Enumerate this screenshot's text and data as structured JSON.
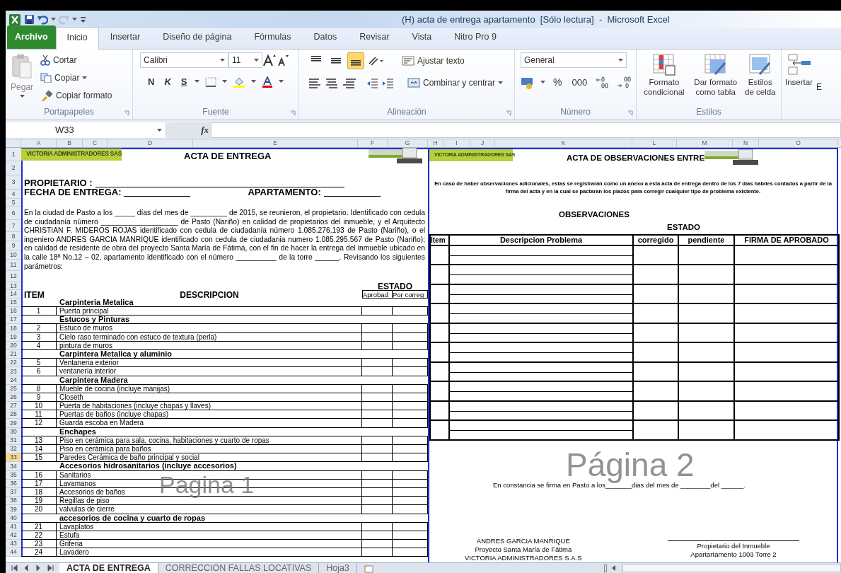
{
  "window": {
    "title": "(H) acta de entrega apartamento  [Sólo lectura]  -  Microsoft Excel"
  },
  "ribbon_tabs": [
    {
      "label": "Archivo",
      "kind": "file",
      "selected": false
    },
    {
      "label": "Inicio",
      "kind": "tab",
      "selected": true
    },
    {
      "label": "Insertar",
      "kind": "tab",
      "selected": false
    },
    {
      "label": "Diseño de página",
      "kind": "tab",
      "selected": false
    },
    {
      "label": "Fórmulas",
      "kind": "tab",
      "selected": false
    },
    {
      "label": "Datos",
      "kind": "tab",
      "selected": false
    },
    {
      "label": "Revisar",
      "kind": "tab",
      "selected": false
    },
    {
      "label": "Vista",
      "kind": "tab",
      "selected": false
    },
    {
      "label": "Nitro Pro 9",
      "kind": "tab",
      "selected": false
    }
  ],
  "clipboard": {
    "paste": "Pegar",
    "cut": "Cortar",
    "copy": "Copiar",
    "format_painter": "Copiar formato",
    "group": "Portapapeles"
  },
  "font": {
    "name": "Calibri",
    "size": "11",
    "bold": "N",
    "italic": "K",
    "underline": "S",
    "group": "Fuente"
  },
  "alignment": {
    "wrap": "Ajustar texto",
    "merge": "Combinar y centrar",
    "group": "Alineación",
    "vertical": [
      {
        "selected": false
      },
      {
        "selected": false
      },
      {
        "selected": true
      }
    ]
  },
  "number": {
    "format": "General",
    "percent": "%",
    "thousands": "000",
    "group": "Número"
  },
  "styles": {
    "conditional": "Formato condicional",
    "table": "Dar formato como tabla",
    "cell": "Estilos de celda",
    "group": "Estilos"
  },
  "cells": {
    "insert": "Insertar",
    "next": "E"
  },
  "formula_bar": {
    "name_box": "W33",
    "fx": "fx"
  },
  "columns_left": [
    "A",
    "B",
    "C",
    "D",
    "E",
    "F",
    "G"
  ],
  "columns_right": [
    "H",
    "I",
    "J",
    "K",
    "L",
    "M",
    "N",
    "O"
  ],
  "row_headers": [
    {
      "label": "1",
      "selected": false
    },
    {
      "label": "2",
      "selected": false
    },
    {
      "label": "3",
      "selected": false
    },
    {
      "label": "4",
      "selected": false
    },
    {
      "label": "5",
      "selected": false
    },
    {
      "label": "6",
      "selected": false
    },
    {
      "label": "7",
      "selected": false
    },
    {
      "label": "8",
      "selected": false
    },
    {
      "label": "9",
      "selected": false
    },
    {
      "label": "10",
      "selected": false
    },
    {
      "label": "11",
      "selected": false
    },
    {
      "label": "12",
      "selected": false
    },
    {
      "label": "13",
      "selected": false
    },
    {
      "label": "14",
      "selected": false
    },
    {
      "label": "15",
      "selected": false
    },
    {
      "label": "16",
      "selected": false
    },
    {
      "label": "17",
      "selected": false
    },
    {
      "label": "18",
      "selected": false
    },
    {
      "label": "19",
      "selected": false
    },
    {
      "label": "20",
      "selected": false
    },
    {
      "label": "21",
      "selected": false
    },
    {
      "label": "22",
      "selected": false
    },
    {
      "label": "23",
      "selected": false
    },
    {
      "label": "24",
      "selected": false
    },
    {
      "label": "25",
      "selected": false
    },
    {
      "label": "26",
      "selected": false
    },
    {
      "label": "27",
      "selected": false
    },
    {
      "label": "28",
      "selected": false
    },
    {
      "label": "29",
      "selected": false
    },
    {
      "label": "30",
      "selected": false
    },
    {
      "label": "31",
      "selected": false
    },
    {
      "label": "32",
      "selected": false
    },
    {
      "label": "33",
      "selected": true
    },
    {
      "label": "34",
      "selected": false
    },
    {
      "label": "35",
      "selected": false
    },
    {
      "label": "36",
      "selected": false
    },
    {
      "label": "37",
      "selected": false
    },
    {
      "label": "38",
      "selected": false
    },
    {
      "label": "39",
      "selected": false
    },
    {
      "label": "40",
      "selected": false
    },
    {
      "label": "41",
      "selected": false
    },
    {
      "label": "42",
      "selected": false
    },
    {
      "label": "43",
      "selected": false
    },
    {
      "label": "44",
      "selected": false
    }
  ],
  "page1": {
    "logo_text": "VICTORIA ADMINISTRADORES SAS",
    "title": "ACTA DE ENTREGA",
    "owner_label": "PROPIETARIO :",
    "date_label": "FECHA DE ENTREGA:",
    "apartment_label": "APARTAMENTO:",
    "paragraph": "En la ciudad de Pasto a los _____ días del mes de _________ de 2015, se reunieron, el propietario. Identificado con cedula de ciudadanía número ___________________ de Pasto (Nariño) en calidad de propietarios del inmueble, y el Arquitecto CHRISTIAN F. MIDEROS ROJAS identificado con cedula de ciudadanía número 1.085.276.193 de Pasto (Nariño), o el ingeniero ANDRES GARCIA MANRIQUE identificado con cedula de ciudadania numero 1.085.295.567 de Pasto (Nariño); en calidad de residente de obra del proyecto Santa María de Fátima, con el fin de hacer la entrega del inmueble ubicado en la calle 18ª No.12 – 02, apartamento identificado con el número __________ de la torre ______. Revisando los siguientes parámetros:",
    "status": "ESTADO",
    "item_header": "ITEM",
    "description_header": "DESCRIPCION",
    "approved_header": "Aprobad",
    "to_fix_header": "Por correg",
    "sections": [
      {
        "title": "Carpinteria Metalica",
        "items": [
          {
            "number": "1",
            "description": "Puerta principal"
          }
        ]
      },
      {
        "title": "Estucos y Pinturas",
        "items": [
          {
            "number": "2",
            "description": "Estuco de muros"
          },
          {
            "number": "3",
            "description": "Cielo raso terminado con estuco de textura (perla)"
          },
          {
            "number": "4",
            "description": "pintura de muros"
          }
        ]
      },
      {
        "title": "Carpintera Metalica y aluminio",
        "items": [
          {
            "number": "5",
            "description": "Ventaneria exterior"
          },
          {
            "number": "6",
            "description": "ventaneria interior"
          }
        ]
      },
      {
        "title": "Carpintera Madera",
        "items": [
          {
            "number": "8",
            "description": "Mueble de cocina (incluye manijas)"
          },
          {
            "number": "9",
            "description": "Closeth"
          },
          {
            "number": "10",
            "description": "Puerta de habitaciones (incluye chapas y llaves)"
          },
          {
            "number": "11",
            "description": "Puertas de baños (incluye chapas)"
          },
          {
            "number": "12",
            "description": "Guarda escoba en Madera"
          }
        ]
      },
      {
        "title": "Enchapes",
        "items": [
          {
            "number": "13",
            "description": "Piso en cerámica para sala, cocina, habitaciones y cuarto de ropas"
          },
          {
            "number": "14",
            "description": "Piso en cerámica para baños"
          },
          {
            "number": "15",
            "description": "Paredes Cerámica de baño principal y social"
          }
        ]
      },
      {
        "title": "Accesorios hidrosanitarios (incluye accesorios)",
        "items": [
          {
            "number": "16",
            "description": "Sanitarios"
          },
          {
            "number": "17",
            "description": "Lavamanos"
          },
          {
            "number": "18",
            "description": "Accesorios de baños"
          },
          {
            "number": "19",
            "description": "Regillas de piso"
          },
          {
            "number": "20",
            "description": "valvulas de cierre"
          }
        ]
      },
      {
        "title": "accesorios de cocina y cuarto de ropas",
        "items": [
          {
            "number": "21",
            "description": "Lavaplatos"
          },
          {
            "number": "22",
            "description": "Estufa"
          },
          {
            "number": "23",
            "description": "Griferia"
          },
          {
            "number": "24",
            "description": "Lavadero"
          }
        ]
      }
    ],
    "watermark": "Pagina 1"
  },
  "page2": {
    "logo_text": "VICTORIA ADMINISTRADORES SAS",
    "title": "ACTA DE OBSERVACIONES ENTRE",
    "notice": "En caso de haber observaciones adicionales, estas se registraran como un anexo a esta acta de entrega dentro de los 7 días hábiles contados a partir de la firma del acta y en la cual se pactaran los plazos para corregir cualquier tipo de problema existente.",
    "observations": "OBSERVACIONES",
    "status": "ESTADO",
    "columns": [
      "Item",
      "Descripcion Problema",
      "corregido",
      "pendiente",
      "FIRMA DE APROBADO"
    ],
    "watermark": "Página 2",
    "closing": "En constancia se firma en Pasto a los_______dias del mes de ________del ______.",
    "signature_left": [
      "ANDRES GARCIA MANRIQUE",
      "Proyecto Santa María de Fátima",
      "VICTORIA ADMINISTRADORES S.A.S"
    ],
    "signature_right": [
      "Propietario del Inmueble",
      "Apartartamento 1003 Torre 2"
    ]
  },
  "sheet_tabs": [
    {
      "label": "ACTA DE ENTREGA",
      "selected": true
    },
    {
      "label": "CORRECCION FALLAS LOCATIVAS",
      "selected": false
    },
    {
      "label": "Hoja3",
      "selected": false
    }
  ]
}
